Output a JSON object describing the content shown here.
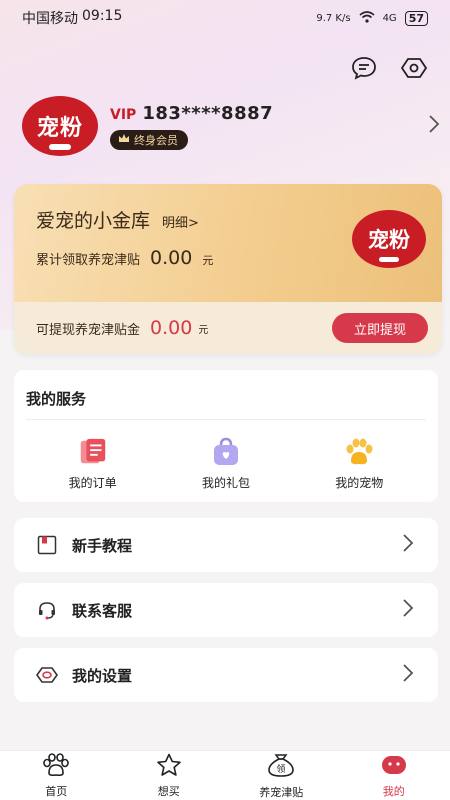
{
  "status_bar": {
    "carrier": "中国移动",
    "time": "09:15",
    "net_speed": "9.7 K/s",
    "signal": "4G",
    "battery": "57"
  },
  "profile": {
    "logo_text": "宠粉",
    "vip": "VIP",
    "phone": "183****8887",
    "member_badge": "终身会员"
  },
  "gold_card": {
    "title": "爱宠的小金库",
    "detail_link": "明细>",
    "total_label": "累计领取养宠津贴",
    "total_value": "0.00",
    "total_unit": "元",
    "logo_text": "宠粉",
    "withdrawable_label": "可提现养宠津贴金",
    "withdrawable_value": "0.00",
    "withdrawable_unit": "元",
    "withdraw_button": "立即提现"
  },
  "services": {
    "title": "我的服务",
    "items": [
      {
        "label": "我的订单",
        "icon": "orders-icon"
      },
      {
        "label": "我的礼包",
        "icon": "gift-bag-icon"
      },
      {
        "label": "我的宠物",
        "icon": "paw-icon"
      }
    ]
  },
  "menu": [
    {
      "label": "新手教程",
      "icon": "tutorial-icon"
    },
    {
      "label": "联系客服",
      "icon": "headset-icon"
    },
    {
      "label": "我的设置",
      "icon": "settings-icon"
    }
  ],
  "bottom_nav": [
    {
      "label": "首页",
      "icon": "paw-home-icon"
    },
    {
      "label": "想买",
      "icon": "star-icon"
    },
    {
      "label": "养宠津贴",
      "icon": "money-bag-icon"
    },
    {
      "label": "我的",
      "icon": "profile-face-icon",
      "active": true
    }
  ],
  "colors": {
    "accent": "#d6394a",
    "brand_red": "#c81d25",
    "gold": "#f3cd8f"
  }
}
